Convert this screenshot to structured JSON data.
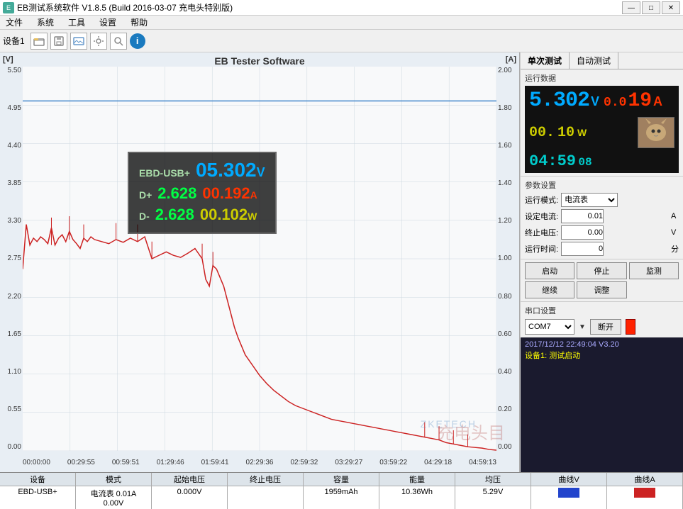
{
  "window": {
    "title": "EB测试系统软件 V1.8.5 (Build 2016-03-07 充电头特别版)",
    "controls": [
      "—",
      "□",
      "✕"
    ]
  },
  "menu": {
    "items": [
      "文件",
      "系统",
      "工具",
      "设置",
      "帮助"
    ]
  },
  "toolbar": {
    "label": "设备1",
    "info_label": "i"
  },
  "chart": {
    "title": "EB Tester Software",
    "unit_v": "[V]",
    "unit_a": "[A]",
    "y_left": [
      "5.50",
      "4.95",
      "4.40",
      "3.85",
      "3.30",
      "2.75",
      "2.20",
      "1.65",
      "1.10",
      "0.55",
      "0.00"
    ],
    "y_right": [
      "2.00",
      "1.80",
      "1.60",
      "1.40",
      "1.20",
      "1.00",
      "0.80",
      "0.60",
      "0.40",
      "0.20",
      "0.00"
    ],
    "x_labels": [
      "00:00:00",
      "00:29:55",
      "00:59:51",
      "01:29:46",
      "01:59:41",
      "02:29:36",
      "02:59:32",
      "03:29:27",
      "03:59:22",
      "04:29:18",
      "04:59:13"
    ],
    "watermark": "ZKETECH",
    "overlay": {
      "label": "EBD-USB+",
      "voltage": "05.302",
      "voltage_unit": "V",
      "d_plus_label": "D+",
      "d_plus_val": "2.628",
      "d_minus_label": "D-",
      "d_minus_val": "2.628",
      "current": "00.192",
      "current_unit": "A",
      "power": "00.102",
      "power_unit": "W"
    }
  },
  "right_panel": {
    "tabs": [
      "单次测试",
      "自动测试"
    ],
    "running_data": {
      "title": "运行数据",
      "voltage": "5.302",
      "voltage_unit": "V",
      "current_prefix": "0.0",
      "current_val": "19",
      "current_unit": "A",
      "power_prefix": "00.",
      "power_val": "10",
      "power_unit": "W",
      "time": "04:59",
      "time_small": "08"
    },
    "params": {
      "title": "参数设置",
      "mode_label": "运行模式:",
      "mode_value": "电流表",
      "current_label": "设定电流:",
      "current_value": "0.01",
      "current_unit": "A",
      "voltage_label": "终止电压:",
      "voltage_value": "0.00",
      "voltage_unit": "V",
      "time_label": "运行时间:",
      "time_value": "0",
      "time_unit": "分"
    },
    "buttons": {
      "start": "启动",
      "stop": "停止",
      "monitor": "监测",
      "continue": "继续",
      "adjust": "调整"
    },
    "port": {
      "title": "串口设置",
      "port_value": "COM7",
      "disconnect_label": "断开"
    },
    "log": {
      "line1": "2017/12/12 22:49:04  V3.20",
      "line2": "设备1: 测试启动"
    }
  },
  "status_bar": {
    "headers": [
      "设备",
      "模式",
      "起始电压",
      "终止电压",
      "容量",
      "能量",
      "均压",
      "曲线V",
      "曲线A"
    ],
    "row": [
      "EBD-USB+",
      "电流表 0.01A 0.00V",
      "0.000V",
      "",
      "1959mAh",
      "10.36Wh",
      "5.29V",
      "",
      ""
    ]
  }
}
